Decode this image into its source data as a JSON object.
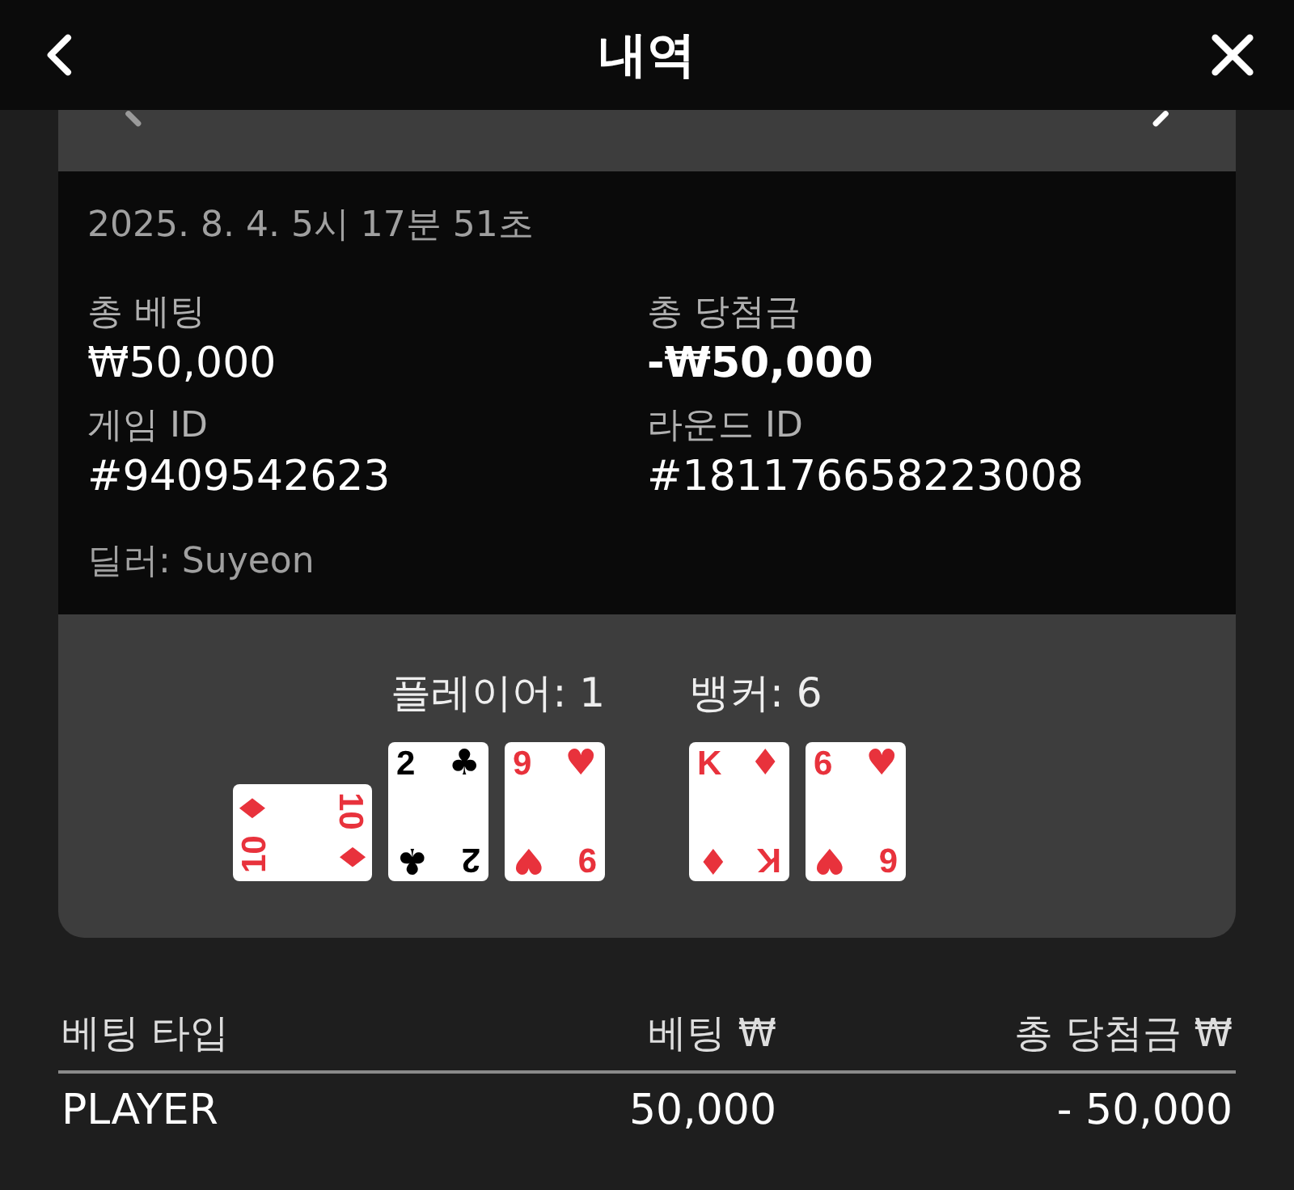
{
  "header": {
    "title": "내역"
  },
  "details": {
    "timestamp": "2025. 8. 4. 5시 17분 51초",
    "fields": [
      {
        "label": "총 베팅",
        "value": "₩50,000",
        "emphasis": false
      },
      {
        "label": "총 당첨금",
        "value": "-₩50,000",
        "emphasis": true
      },
      {
        "label": "게임 ID",
        "value": "#9409542623",
        "emphasis": false
      },
      {
        "label": "라운드 ID",
        "value": "#181176658223008",
        "emphasis": false
      }
    ],
    "dealer": "딜러: Suyeon"
  },
  "hands": [
    {
      "score": "플레이어: 1",
      "cards": [
        {
          "corners": [
            {
              "rank": "10",
              "suit": "♦"
            },
            {
              "rank": "10",
              "suit": "♦"
            }
          ],
          "color": "#e8323c",
          "rotated": true
        },
        {
          "corners": [
            {
              "rank": "2",
              "suit": "♣"
            },
            {
              "rank": "2",
              "suit": "♣"
            }
          ],
          "color": "#000000",
          "rotated": false
        },
        {
          "corners": [
            {
              "rank": "9",
              "suit": "♥"
            },
            {
              "rank": "9",
              "suit": "♥"
            }
          ],
          "color": "#e8323c",
          "rotated": false
        }
      ]
    },
    {
      "score": "뱅커: 6",
      "cards": [
        {
          "corners": [
            {
              "rank": "K",
              "suit": "♦"
            },
            {
              "rank": "K",
              "suit": "♦"
            }
          ],
          "color": "#e8323c",
          "rotated": false
        },
        {
          "corners": [
            {
              "rank": "6",
              "suit": "♥"
            },
            {
              "rank": "6",
              "suit": "♥"
            }
          ],
          "color": "#e8323c",
          "rotated": false
        }
      ]
    }
  ],
  "table": {
    "columns": [
      "베팅 타입",
      "베팅 ₩",
      "총 당첨금 ₩"
    ],
    "rows": [
      [
        "PLAYER",
        "50,000",
        "- 50,000"
      ]
    ]
  }
}
